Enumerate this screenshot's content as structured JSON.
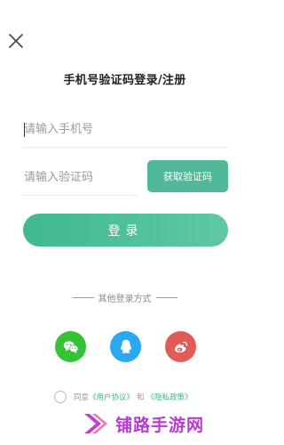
{
  "header": {
    "close_icon": "close-icon"
  },
  "title": "手机号验证码登录/注册",
  "form": {
    "phone_placeholder": "请输入手机号",
    "code_placeholder": "请输入验证码",
    "get_code_label": "获取验证码",
    "login_label": "登录"
  },
  "other_login": {
    "label": "其他登录方式",
    "providers": [
      {
        "name": "wechat",
        "icon": "wechat-icon",
        "color": "#35c335"
      },
      {
        "name": "qq",
        "icon": "qq-icon",
        "color": "#2aa8f2"
      },
      {
        "name": "weibo",
        "icon": "weibo-icon",
        "color": "#e15c57"
      }
    ]
  },
  "agreement": {
    "prefix": "同意",
    "user_agreement": "《用户协议》",
    "and": "和",
    "privacy_policy": "《隐私政策》"
  },
  "watermark": {
    "text": "铺路手游网"
  },
  "colors": {
    "accent": "#52b89a",
    "link": "#3fb48d",
    "watermark": "#b83bd0"
  }
}
